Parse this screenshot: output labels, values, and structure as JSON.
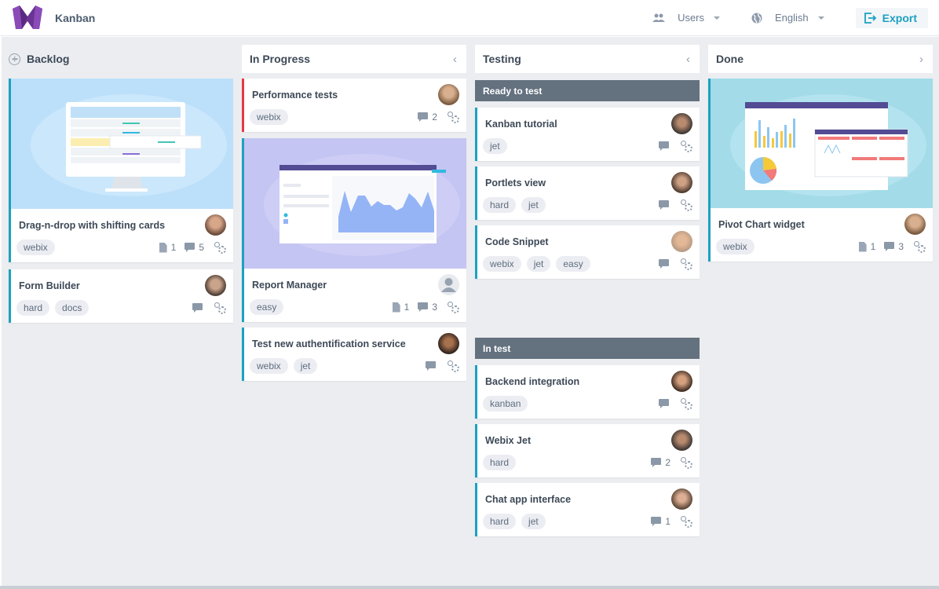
{
  "toolbar": {
    "app_title": "Kanban",
    "users_label": "Users",
    "language_label": "English",
    "export_label": "Export"
  },
  "colors": {
    "accent": "#1ca1c1",
    "urgent": "#e53945",
    "subheader": "#64717f",
    "brand": "#7b3fa0"
  },
  "columns": [
    {
      "title": "Backlog",
      "icon": "plus-circle-icon"
    },
    {
      "title": "In Progress",
      "icon": "chevron-left-icon"
    },
    {
      "title": "Testing",
      "icon": "chevron-left-icon",
      "subgroups": [
        "Ready to test",
        "In test"
      ]
    },
    {
      "title": "Done",
      "icon": "chevron-right-icon"
    }
  ],
  "cards": {
    "backlog": [
      {
        "title": "Drag-n-drop with shifting cards",
        "tags": [
          "webix"
        ],
        "attachments": "1",
        "comments": "5",
        "image": "drag-drop-illustration"
      },
      {
        "title": "Form Builder",
        "tags": [
          "hard",
          "docs"
        ],
        "comments": ""
      }
    ],
    "in_progress": [
      {
        "title": "Performance tests",
        "tags": [
          "webix"
        ],
        "comments": "2",
        "priority": "red"
      },
      {
        "title": "Report Manager",
        "tags": [
          "easy"
        ],
        "attachments": "1",
        "comments": "3",
        "image": "report-chart-illustration",
        "avatar": "default-user"
      },
      {
        "title": "Test new authentification service",
        "tags": [
          "webix",
          "jet"
        ],
        "comments": ""
      }
    ],
    "ready_to_test": [
      {
        "title": "Kanban tutorial",
        "tags": [
          "jet"
        ],
        "comments": ""
      },
      {
        "title": "Portlets view",
        "tags": [
          "hard",
          "jet"
        ],
        "comments": ""
      },
      {
        "title": "Code Snippet",
        "tags": [
          "webix",
          "jet",
          "easy"
        ],
        "comments": ""
      }
    ],
    "in_test": [
      {
        "title": "Backend integration",
        "tags": [
          "kanban"
        ],
        "comments": ""
      },
      {
        "title": "Webix Jet",
        "tags": [
          "hard"
        ],
        "comments": "2"
      },
      {
        "title": "Chat app interface",
        "tags": [
          "hard",
          "jet"
        ],
        "comments": "1"
      }
    ],
    "done": [
      {
        "title": "Pivot Chart widget",
        "tags": [
          "webix"
        ],
        "attachments": "1",
        "comments": "3",
        "image": "pivot-dashboard-illustration"
      }
    ]
  }
}
